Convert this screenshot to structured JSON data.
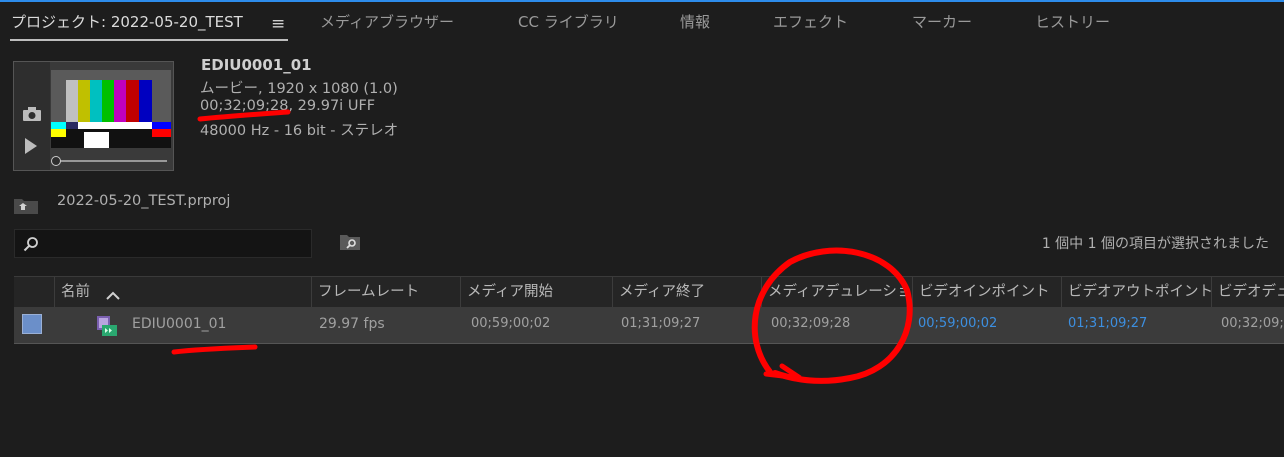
{
  "header": {
    "project_tab": "プロジェクト: 2022-05-20_TEST",
    "tabs": [
      {
        "label": "メディアブラウザー"
      },
      {
        "label": "CC ライブラリ"
      },
      {
        "label": "情報"
      },
      {
        "label": "エフェクト"
      },
      {
        "label": "マーカー"
      },
      {
        "label": "ヒストリー"
      }
    ]
  },
  "preview": {
    "clip_name": "EDIU0001_01",
    "type_line": "ムービー, 1920 x 1080 (1.0)",
    "time_line": "00;32;09;28, 29.97i UFF",
    "audio_line": "48000 Hz - 16 bit - ステレオ"
  },
  "project": {
    "file": "2022-05-20_TEST.prproj"
  },
  "search": {
    "placeholder": "",
    "status": "1 個中 1 個の項目が選択されました"
  },
  "table": {
    "columns": [
      {
        "label": "名前"
      },
      {
        "label": "フレームレート"
      },
      {
        "label": "メディア開始"
      },
      {
        "label": "メディア終了"
      },
      {
        "label": "メディアデュレーション"
      },
      {
        "label": "ビデオインポイント"
      },
      {
        "label": "ビデオアウトポイント"
      },
      {
        "label": "ビデオデュレーション"
      }
    ],
    "rows": [
      {
        "name": "EDIU0001_01",
        "frame_rate": "29.97 fps",
        "media_start": "00;59;00;02",
        "media_end": "01;31;09;27",
        "media_duration": "00;32;09;28",
        "video_in": "00;59;00;02",
        "video_out": "01;31;09;27",
        "video_duration": "00;32;09;28"
      }
    ]
  },
  "colors": {
    "accent_blue": "#2d8ceb",
    "link_blue": "#3c8fe0",
    "annotation_red": "#ff0000"
  }
}
